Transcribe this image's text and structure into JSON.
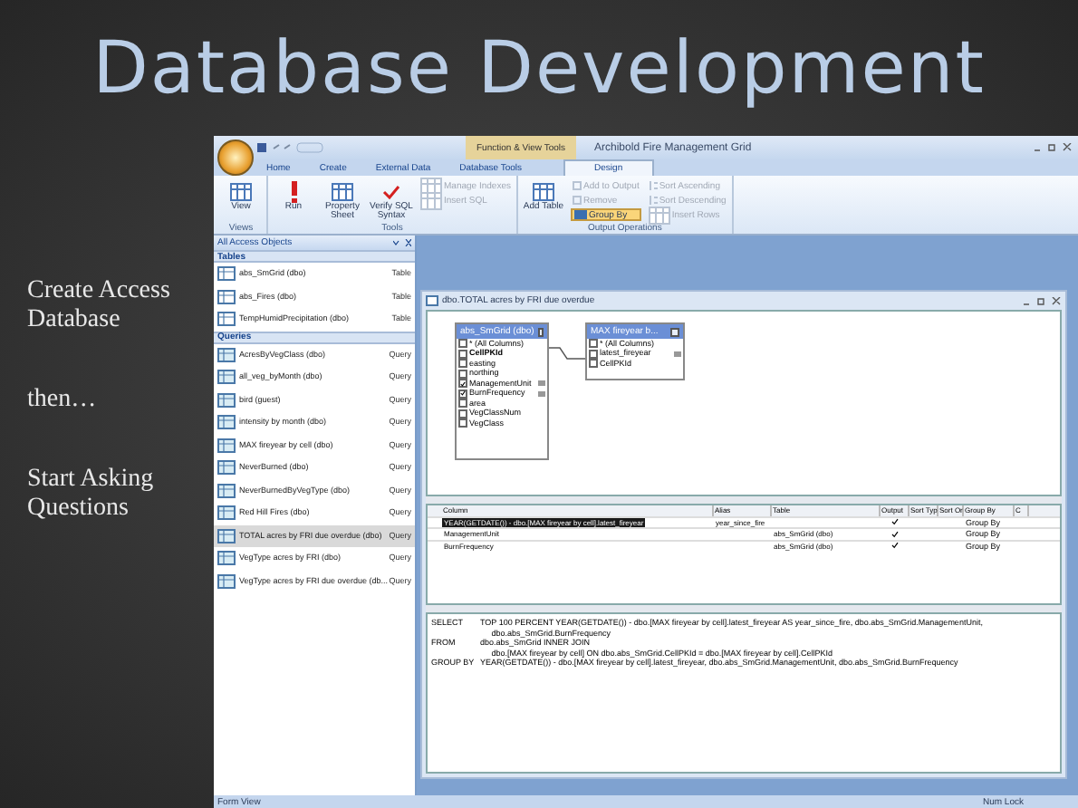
{
  "slide": {
    "title": "Database Development",
    "bullets": [
      "Create Access Database",
      "then…",
      "Start Asking Questions"
    ]
  },
  "app": {
    "title_bar": {
      "context_group": "Function & View Tools",
      "title": "Archibold Fire Management Grid"
    },
    "tabs": [
      {
        "label": "Home",
        "selected": false
      },
      {
        "label": "Create",
        "selected": false
      },
      {
        "label": "External Data",
        "selected": false
      },
      {
        "label": "Database Tools",
        "selected": false
      },
      {
        "label": "Design",
        "selected": true
      }
    ],
    "ribbon": [
      {
        "group": "Views",
        "buttons": [
          {
            "label": "View",
            "kind": "large",
            "disabled": false,
            "selected": false
          }
        ]
      },
      {
        "group": "Tools",
        "buttons": [
          {
            "label": "Run",
            "kind": "large",
            "disabled": false,
            "selected": false
          },
          {
            "label": "Property Sheet",
            "kind": "large",
            "disabled": false,
            "selected": false
          },
          {
            "label": "Verify SQL Syntax",
            "kind": "large",
            "disabled": false,
            "selected": false
          },
          {
            "label": "Manage Indexes",
            "kind": "small",
            "disabled": true,
            "selected": false
          },
          {
            "label": "Insert SQL",
            "kind": "small",
            "disabled": true,
            "selected": false
          }
        ]
      },
      {
        "group": "Output Operations",
        "buttons": [
          {
            "label": "Add Table",
            "kind": "large",
            "disabled": false,
            "selected": false
          },
          {
            "label": "Add to Output",
            "kind": "small",
            "disabled": true,
            "selected": false
          },
          {
            "label": "Remove",
            "kind": "small",
            "disabled": true,
            "selected": false
          },
          {
            "label": "Group By",
            "kind": "small",
            "disabled": false,
            "selected": true
          },
          {
            "label": "Sort Ascending",
            "kind": "small",
            "disabled": true,
            "selected": false
          },
          {
            "label": "Sort Descending",
            "kind": "small",
            "disabled": true,
            "selected": false
          },
          {
            "label": "Insert Rows",
            "kind": "small",
            "disabled": true,
            "selected": false
          }
        ]
      }
    ],
    "nav_pane": {
      "header": "All Access Objects",
      "sections": [
        {
          "title": "Tables",
          "items": [
            {
              "name": "abs_SmGrid (dbo)",
              "type": "Table",
              "selected": false
            },
            {
              "name": "abs_Fires (dbo)",
              "type": "Table",
              "selected": false
            },
            {
              "name": "TempHumidPrecipitation (dbo)",
              "type": "Table",
              "selected": false
            }
          ]
        },
        {
          "title": "Queries",
          "items": [
            {
              "name": "AcresByVegClass (dbo)",
              "type": "Query",
              "selected": false
            },
            {
              "name": "all_veg_byMonth (dbo)",
              "type": "Query",
              "selected": false
            },
            {
              "name": "bird (guest)",
              "type": "Query",
              "selected": false
            },
            {
              "name": "intensity by month (dbo)",
              "type": "Query",
              "selected": false
            },
            {
              "name": "MAX fireyear by cell (dbo)",
              "type": "Query",
              "selected": false
            },
            {
              "name": "NeverBurned (dbo)",
              "type": "Query",
              "selected": false
            },
            {
              "name": "NeverBurnedByVegType (dbo)",
              "type": "Query",
              "selected": false
            },
            {
              "name": "Red Hill Fires (dbo)",
              "type": "Query",
              "selected": false
            },
            {
              "name": "TOTAL acres by FRI due overdue (dbo)",
              "type": "Query",
              "selected": true
            },
            {
              "name": "VegType acres by FRI (dbo)",
              "type": "Query",
              "selected": false
            },
            {
              "name": "VegType acres by FRI due overdue (db...",
              "type": "Query",
              "selected": false
            }
          ]
        }
      ]
    },
    "query_window": {
      "title": "dbo.TOTAL acres by FRI due overdue",
      "tables": [
        {
          "title": "abs_SmGrid (dbo)",
          "fields": [
            {
              "name": "* (All Columns)",
              "checked": false,
              "key": false,
              "grouped": false
            },
            {
              "name": "CellPKId",
              "checked": false,
              "key": true,
              "grouped": false
            },
            {
              "name": "easting",
              "checked": false,
              "key": false,
              "grouped": false
            },
            {
              "name": "northing",
              "checked": false,
              "key": false,
              "grouped": false
            },
            {
              "name": "ManagementUnit",
              "checked": true,
              "key": false,
              "grouped": true
            },
            {
              "name": "BurnFrequency",
              "checked": true,
              "key": false,
              "grouped": true
            },
            {
              "name": "area",
              "checked": false,
              "key": false,
              "grouped": false
            },
            {
              "name": "VegClassNum",
              "checked": false,
              "key": false,
              "grouped": false
            },
            {
              "name": "VegClass",
              "checked": false,
              "key": false,
              "grouped": false
            }
          ]
        },
        {
          "title": "MAX fireyear b...",
          "fields": [
            {
              "name": "* (All Columns)",
              "checked": false,
              "key": false,
              "grouped": false
            },
            {
              "name": "latest_fireyear",
              "checked": false,
              "key": false,
              "grouped": true
            },
            {
              "name": "CellPKId",
              "checked": false,
              "key": false,
              "grouped": false
            }
          ]
        }
      ],
      "grid": {
        "columns": [
          "Column",
          "Alias",
          "Table",
          "Output",
          "Sort Typ",
          "Sort Or",
          "Group By",
          "C"
        ],
        "rows": [
          {
            "column": "YEAR(GETDATE()) - dbo.[MAX fireyear by cell].latest_fireyear",
            "alias": "year_since_fire",
            "table": "",
            "output": true,
            "group_by": "Group By",
            "selected": true
          },
          {
            "column": "ManagementUnit",
            "alias": "",
            "table": "abs_SmGrid (dbo)",
            "output": true,
            "group_by": "Group By",
            "selected": false
          },
          {
            "column": "BurnFrequency",
            "alias": "",
            "table": "abs_SmGrid (dbo)",
            "output": true,
            "group_by": "Group By",
            "selected": false
          }
        ]
      },
      "sql": [
        {
          "keyword": "SELECT",
          "lines": [
            "TOP 100 PERCENT YEAR(GETDATE()) - dbo.[MAX fireyear by cell].latest_fireyear AS year_since_fire, dbo.abs_SmGrid.ManagementUnit,",
            "     dbo.abs_SmGrid.BurnFrequency"
          ]
        },
        {
          "keyword": "FROM",
          "lines": [
            "dbo.abs_SmGrid INNER JOIN",
            "     dbo.[MAX fireyear by cell] ON dbo.abs_SmGrid.CellPKId = dbo.[MAX fireyear by cell].CellPKId"
          ]
        },
        {
          "keyword": "GROUP BY",
          "lines": [
            "YEAR(GETDATE()) - dbo.[MAX fireyear by cell].latest_fireyear, dbo.abs_SmGrid.ManagementUnit, dbo.abs_SmGrid.BurnFrequency"
          ]
        }
      ]
    },
    "status_bar": {
      "left": "Form View",
      "right": "Num Lock"
    }
  }
}
